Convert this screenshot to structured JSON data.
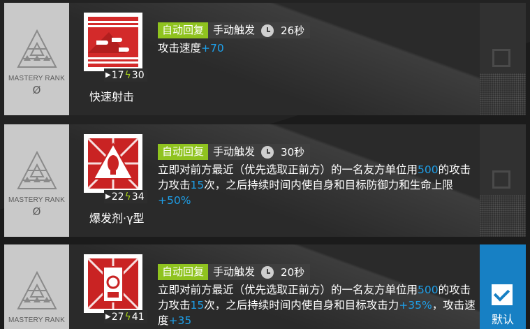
{
  "skills": [
    {
      "name": "快速射击",
      "mastery_label": "MASTERY RANK",
      "mastery_value": "Ø",
      "sp_init": "17",
      "sp_cost": "30",
      "recovery": "自动回复",
      "trigger": "手动触发",
      "duration": "26秒",
      "desc_parts": [
        {
          "t": "攻击速度",
          "hl": false
        },
        {
          "t": "+70",
          "hl": true
        }
      ],
      "selected": false,
      "icon": "rapid-fire-icon"
    },
    {
      "name": "爆发剂·γ型",
      "mastery_label": "MASTERY RANK",
      "mastery_value": "Ø",
      "sp_init": "22",
      "sp_cost": "34",
      "recovery": "自动回复",
      "trigger": "手动触发",
      "duration": "30秒",
      "desc_parts": [
        {
          "t": "立即对前方最近（优先选取正前方）的一名友方单位用",
          "hl": false
        },
        {
          "t": "500",
          "hl": true
        },
        {
          "t": "的攻击力攻击",
          "hl": false
        },
        {
          "t": "15",
          "hl": true
        },
        {
          "t": "次，之后持续时间内使自身和目标防御力和生命上限",
          "hl": false
        },
        {
          "t": "+50%",
          "hl": true
        }
      ],
      "selected": false,
      "icon": "burst-agent-gamma-icon"
    },
    {
      "name": "",
      "mastery_label": "MASTERY RANK",
      "mastery_value": "Ø",
      "sp_init": "27",
      "sp_cost": "41",
      "recovery": "自动回复",
      "trigger": "手动触发",
      "duration": "20秒",
      "desc_parts": [
        {
          "t": "立即对前方最近（优先选取正前方）的一名友方单位用",
          "hl": false
        },
        {
          "t": "500",
          "hl": true
        },
        {
          "t": "的攻击力攻击",
          "hl": false
        },
        {
          "t": "15",
          "hl": true
        },
        {
          "t": "次，之后持续时间内使自身和目标攻击力",
          "hl": false
        },
        {
          "t": "+35%",
          "hl": true
        },
        {
          "t": "，攻击速度",
          "hl": false
        },
        {
          "t": "+35",
          "hl": true
        }
      ],
      "selected": true,
      "default_label": "默认",
      "icon": "burst-agent-icon"
    }
  ],
  "colors": {
    "auto_tag": "#8fc31f",
    "highlight": "#1ea0ea",
    "selected": "#1780c4",
    "sp_bolt": "#a8d21c"
  }
}
